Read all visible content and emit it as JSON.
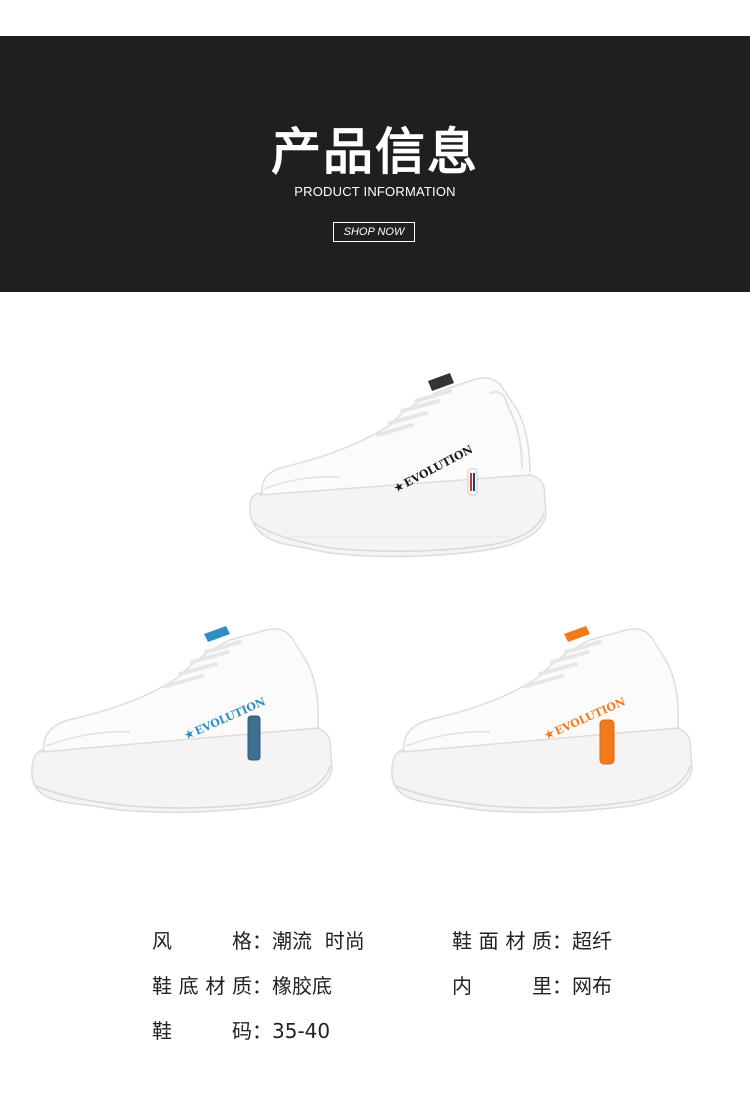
{
  "header": {
    "title": "产品信息",
    "subtitle": "PRODUCT INFORMATION",
    "button_label": "SHOP NOW"
  },
  "products": [
    {
      "accent": "#c8362a",
      "tag_text": "EVOLUTION",
      "tag_color": "#1a1a1a",
      "tab_colors": [
        "#c8362a",
        "#2a3a66",
        "#1a1a1a"
      ]
    },
    {
      "accent": "#2f8fc2",
      "tag_text": "EVOLUTION",
      "tag_color": "#2f8fc2",
      "tab_colors": [
        "#3f6e93"
      ]
    },
    {
      "accent": "#f27a1a",
      "tag_text": "EVOLUTION",
      "tag_color": "#f27a1a",
      "tab_colors": [
        "#f27a1a"
      ]
    }
  ],
  "specs": {
    "style": {
      "label": "风　格",
      "colon": "：",
      "value": "潮流  时尚"
    },
    "upper": {
      "label": "鞋面材质",
      "colon": "：",
      "value": "超纤"
    },
    "sole": {
      "label": "鞋底材质",
      "colon": "：",
      "value": "橡胶底"
    },
    "lining": {
      "label": "内　里",
      "colon": "：",
      "value": "网布"
    },
    "size": {
      "label": "鞋　码",
      "colon": "：",
      "value": "35-40"
    }
  }
}
